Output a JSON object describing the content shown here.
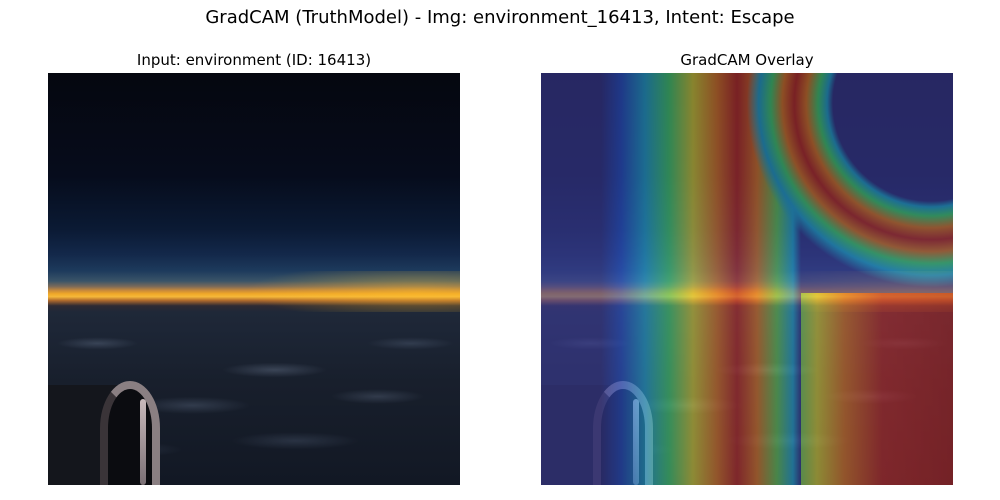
{
  "figure": {
    "suptitle": "GradCAM (TruthModel) - Img: environment_16413, Intent: Escape"
  },
  "panels": [
    {
      "title": "Input: environment (ID: 16413)"
    },
    {
      "title": "GradCAM Overlay"
    }
  ]
}
